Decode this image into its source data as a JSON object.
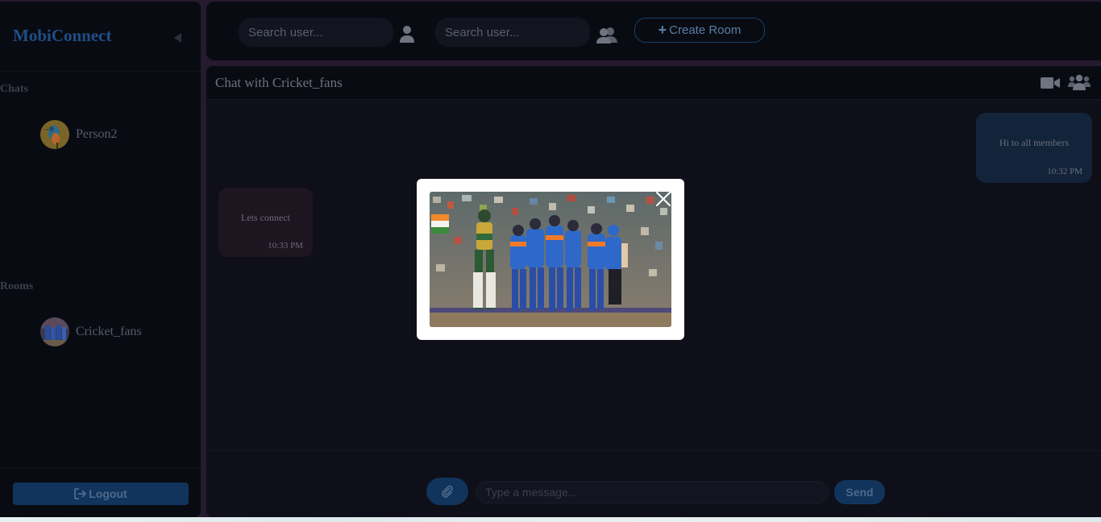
{
  "sidebar": {
    "brand": "MobiConnect",
    "chats_heading": "Chats",
    "chats": [
      {
        "name": "Person2",
        "avatar": "kingfisher-bird-avatar"
      }
    ],
    "rooms_heading": "Rooms",
    "rooms": [
      {
        "name": "Cricket_fans",
        "avatar": "cricket-team-avatar"
      }
    ],
    "logout_label": "Logout"
  },
  "topbar": {
    "user_search_placeholder": "Search user...",
    "group_search_placeholder": "Search user...",
    "create_room_label": "Create Room"
  },
  "chat": {
    "title": "Chat with Cricket_fans",
    "messages": [
      {
        "direction": "outgoing",
        "text": "Hi to all members",
        "time": "10:32 PM"
      },
      {
        "direction": "incoming",
        "text": "Lets connect",
        "time": "10:33 PM"
      }
    ],
    "input_placeholder": "Type a message...",
    "send_label": "Send"
  },
  "modal": {
    "image": "cricket-team-celebration-photo",
    "close_icon": "close-icon"
  },
  "colors": {
    "accent": "#11345c",
    "brand": "#1e4f86",
    "background": "#090b12",
    "chat_background": "#0e0f18",
    "outgoing_bubble": "#12233a",
    "incoming_bubble": "#1f1521",
    "modal_background": "#ffffff"
  }
}
